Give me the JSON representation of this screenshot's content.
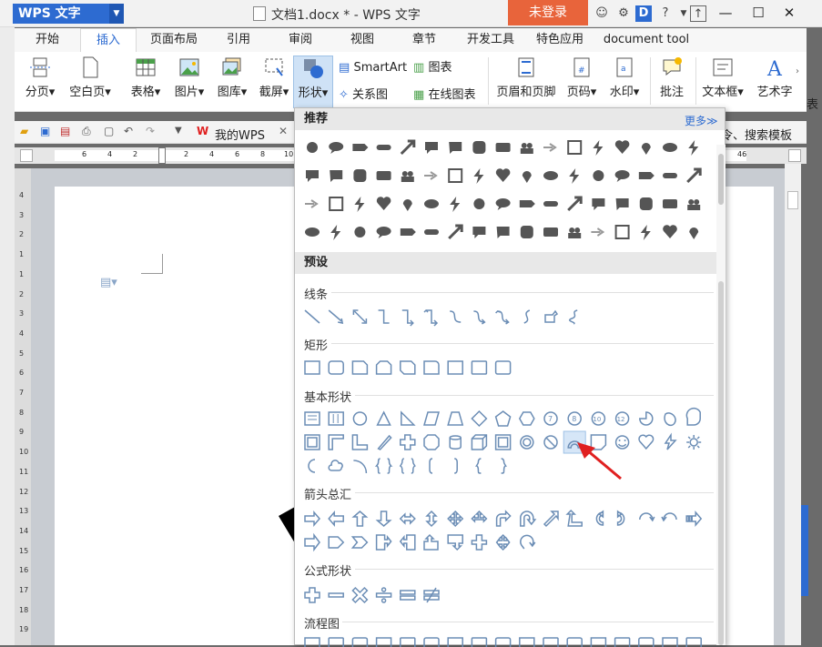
{
  "titlebar": {
    "app_name": "WPS 文字",
    "document_title": "文档1.docx * - WPS 文字",
    "login_label": "未登录",
    "minimize": "—",
    "maximize": "☐",
    "close": "✕"
  },
  "tabs": [
    {
      "label": "开始"
    },
    {
      "label": "插入"
    },
    {
      "label": "页面布局"
    },
    {
      "label": "引用"
    },
    {
      "label": "审阅"
    },
    {
      "label": "视图"
    },
    {
      "label": "章节"
    },
    {
      "label": "开发工具"
    },
    {
      "label": "特色应用"
    },
    {
      "label": "document tool"
    }
  ],
  "ribbon": {
    "page_break": "分页",
    "blank_page": "空白页",
    "table": "表格",
    "picture": "图片",
    "gallery": "图库",
    "screenshot": "截屏",
    "shapes": "形状",
    "smartart": "SmartArt",
    "relation": "关系图",
    "chart": "图表",
    "online_chart": "在线图表",
    "header_footer": "页眉和页脚",
    "page_num": "页码",
    "watermark": "水印",
    "comment": "批注",
    "textbox": "文本框",
    "wordart": "艺术字",
    "right_cut": "表"
  },
  "quickbar": {
    "mywps": "我的WPS",
    "right_text": "令、搜索模板"
  },
  "ruler_labels": [
    "6",
    "4",
    "2",
    "2",
    "4",
    "6",
    "8",
    "10",
    "46"
  ],
  "vruler_labels": [
    "4",
    "3",
    "2",
    "1",
    "1",
    "2",
    "3",
    "4",
    "5",
    "6",
    "7",
    "8",
    "9",
    "10",
    "11",
    "12",
    "13",
    "14",
    "15",
    "16",
    "17",
    "18",
    "19"
  ],
  "dropdown": {
    "recommended_title": "推荐",
    "more_label": "更多≫",
    "preset_title": "预设",
    "groups": [
      {
        "label": "线条"
      },
      {
        "label": "矩形"
      },
      {
        "label": "基本形状"
      },
      {
        "label": "箭头总汇"
      },
      {
        "label": "公式形状"
      },
      {
        "label": "流程图"
      }
    ],
    "highlight_color": "#d6e6f7",
    "arrow_color": "#e02020"
  }
}
